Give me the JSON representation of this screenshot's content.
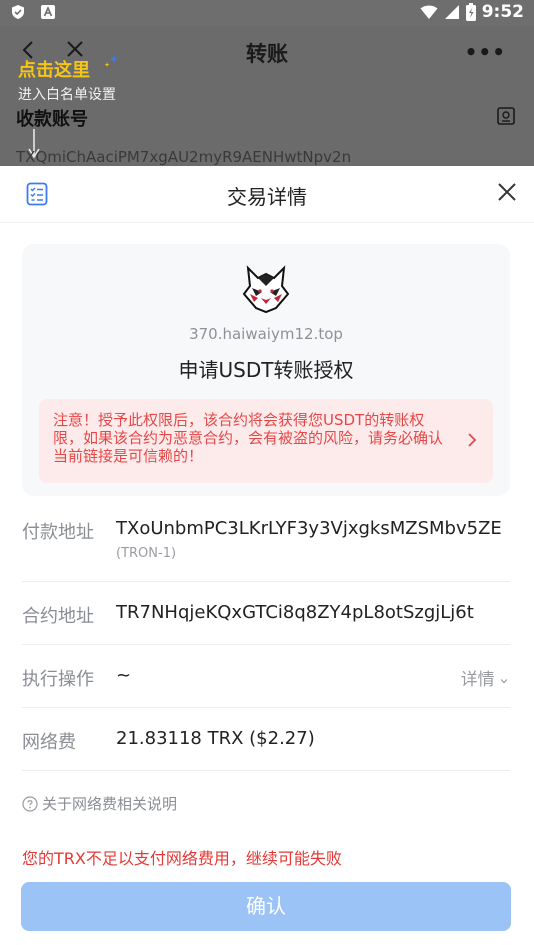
{
  "status_bar": {
    "time": "9:52"
  },
  "background": {
    "title": "转账",
    "hint": "点击这里",
    "subhint": "进入白名单设置",
    "receive_label": "收款账号",
    "receive_address": "TXQmiChAaciPM7xgAU2myR9AENHwtNpv2n"
  },
  "sheet": {
    "title": "交易详情",
    "dapp": {
      "domain": "370.haiwaiym12.top",
      "request": "申请USDT转账授权",
      "warning": "注意！授予此权限后，该合约将会获得您USDT的转账权限，如果该合约为恶意合约，会有被盗的风险，请务必确认当前链接是可信赖的！"
    },
    "rows": {
      "payer_label": "付款地址",
      "payer_value": "TXoUnbmPC3LKrLYF3y3VjxgksMZSMbv5ZE",
      "payer_network": "(TRON-1)",
      "contract_label": "合约地址",
      "contract_value": "TR7NHqjeKQxGTCi8q8ZY4pL8otSzgjLj6t",
      "action_label": "执行操作",
      "action_value": "~",
      "action_detail": "详情",
      "fee_label": "网络费",
      "fee_value": "21.83118 TRX ($2.27)"
    },
    "fee_note": "关于网络费相关说明",
    "error": "您的TRX不足以支付网络费用，继续可能失败",
    "confirm_label": "确认"
  },
  "colors": {
    "accent": "#9cc3f5",
    "error": "#e53935",
    "warning_bg": "#fdebec",
    "hint": "#f5c518"
  }
}
